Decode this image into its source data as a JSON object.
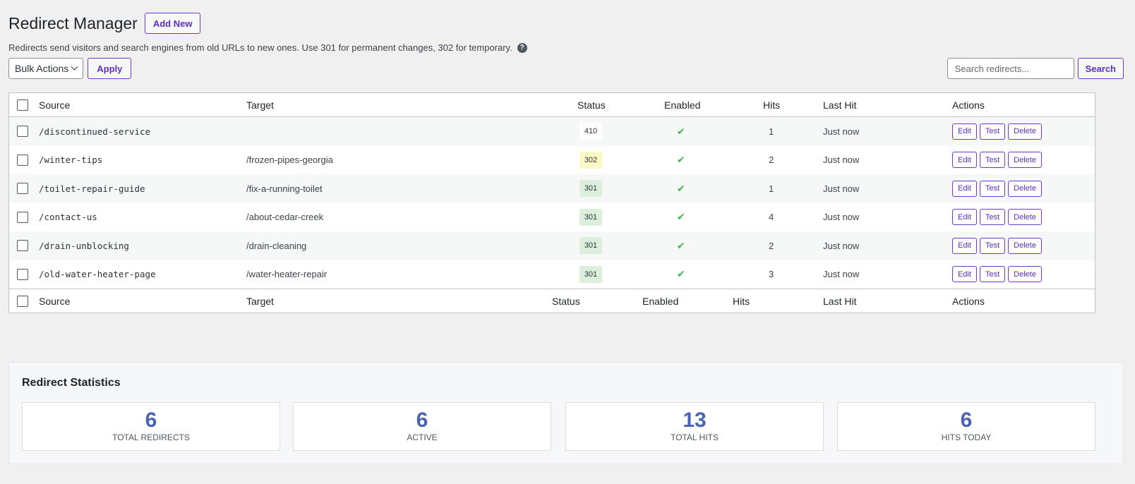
{
  "page": {
    "title": "Redirect Manager",
    "add_new_label": "Add New",
    "description": "Redirects send visitors and search engines from old URLs to new ones. Use 301 for permanent changes, 302 for temporary.",
    "help_glyph": "?"
  },
  "toolbar": {
    "bulk_actions_label": "Bulk Actions",
    "apply_label": "Apply",
    "search_placeholder": "Search redirects...",
    "search_label": "Search"
  },
  "table": {
    "columns": [
      "Source",
      "Target",
      "Status",
      "Enabled",
      "Hits",
      "Last Hit",
      "Actions"
    ],
    "action_labels": {
      "edit": "Edit",
      "test": "Test",
      "delete": "Delete"
    },
    "enabled_glyph": "✔",
    "rows": [
      {
        "source": "/discontinued-service",
        "target": "",
        "status": "410",
        "hits": "1",
        "last_hit": "Just now"
      },
      {
        "source": "/winter-tips",
        "target": "/frozen-pipes-georgia",
        "status": "302",
        "hits": "2",
        "last_hit": "Just now"
      },
      {
        "source": "/toilet-repair-guide",
        "target": "/fix-a-running-toilet",
        "status": "301",
        "hits": "1",
        "last_hit": "Just now"
      },
      {
        "source": "/contact-us",
        "target": "/about-cedar-creek",
        "status": "301",
        "hits": "4",
        "last_hit": "Just now"
      },
      {
        "source": "/drain-unblocking",
        "target": "/drain-cleaning",
        "status": "301",
        "hits": "2",
        "last_hit": "Just now"
      },
      {
        "source": "/old-water-heater-page",
        "target": "/water-heater-repair",
        "status": "301",
        "hits": "3",
        "last_hit": "Just now"
      }
    ]
  },
  "status_colors": {
    "410": "#ffffff",
    "302": "#fcf9c6",
    "301": "#dcefdc"
  },
  "stats": {
    "title": "Redirect Statistics",
    "items": [
      {
        "value": "6",
        "label": "TOTAL REDIRECTS"
      },
      {
        "value": "6",
        "label": "ACTIVE"
      },
      {
        "value": "13",
        "label": "TOTAL HITS"
      },
      {
        "value": "6",
        "label": "HITS TODAY"
      }
    ]
  },
  "colors": {
    "accent": "#5b2fc2",
    "stat_number": "#4a63b3",
    "check": "#46b450"
  }
}
